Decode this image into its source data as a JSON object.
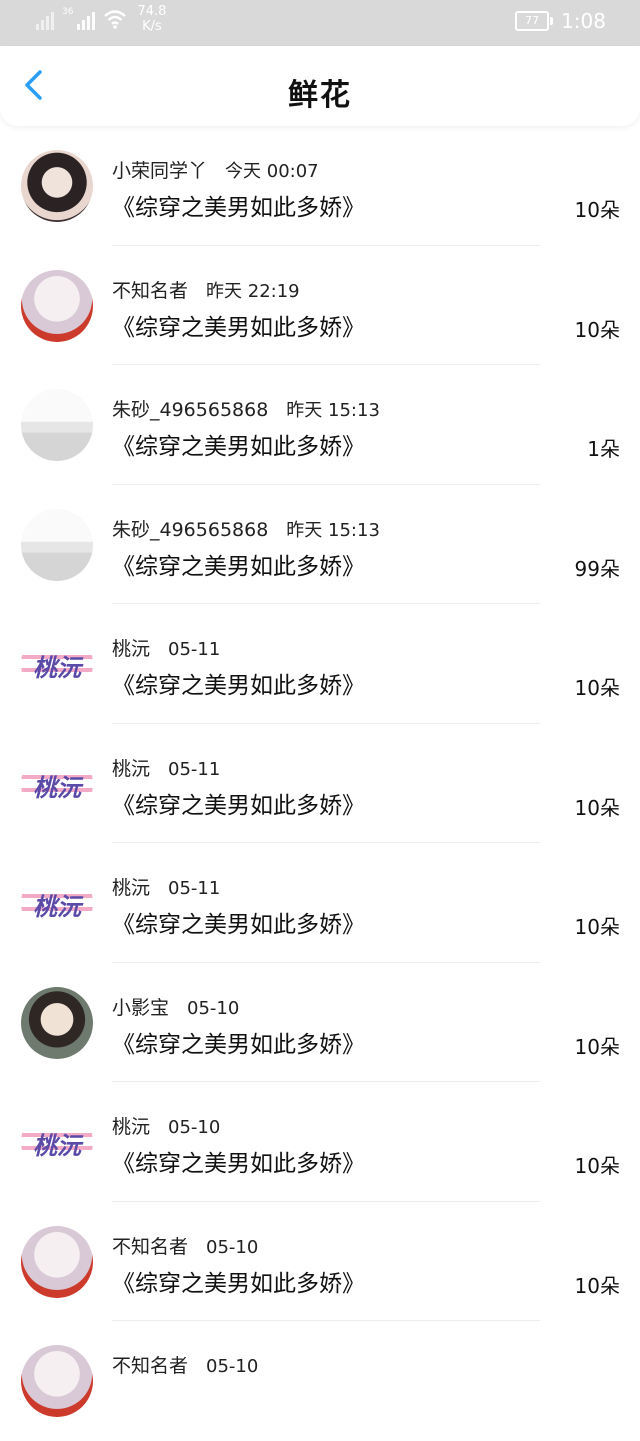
{
  "status_bar": {
    "network_type": "36",
    "speed_value": "74.8",
    "speed_unit": "K/s",
    "battery": "77",
    "time": "1:08"
  },
  "header": {
    "title": "鲜花",
    "back_icon": "chevron-left-icon",
    "accent_color": "#2a9df4"
  },
  "items": [
    {
      "name": "小荣同学丫",
      "time": "今天 00:07",
      "book": "《综穿之美男如此多娇》",
      "count": "10朵"
    },
    {
      "name": "不知名者",
      "time": "昨天 22:19",
      "book": "《综穿之美男如此多娇》",
      "count": "10朵"
    },
    {
      "name": "朱砂_496565868",
      "time": "昨天 15:13",
      "book": "《综穿之美男如此多娇》",
      "count": "1朵"
    },
    {
      "name": "朱砂_496565868",
      "time": "昨天 15:13",
      "book": "《综穿之美男如此多娇》",
      "count": "99朵"
    },
    {
      "name": "桃沅",
      "time": "05-11",
      "book": "《综穿之美男如此多娇》",
      "count": "10朵"
    },
    {
      "name": "桃沅",
      "time": "05-11",
      "book": "《综穿之美男如此多娇》",
      "count": "10朵"
    },
    {
      "name": "桃沅",
      "time": "05-11",
      "book": "《综穿之美男如此多娇》",
      "count": "10朵"
    },
    {
      "name": "小影宝",
      "time": "05-10",
      "book": "《综穿之美男如此多娇》",
      "count": "10朵"
    },
    {
      "name": "桃沅",
      "time": "05-10",
      "book": "《综穿之美男如此多娇》",
      "count": "10朵"
    },
    {
      "name": "不知名者",
      "time": "05-10",
      "book": "《综穿之美男如此多娇》",
      "count": "10朵"
    },
    {
      "name": "不知名者",
      "time": "05-10",
      "book": "",
      "count": ""
    }
  ]
}
